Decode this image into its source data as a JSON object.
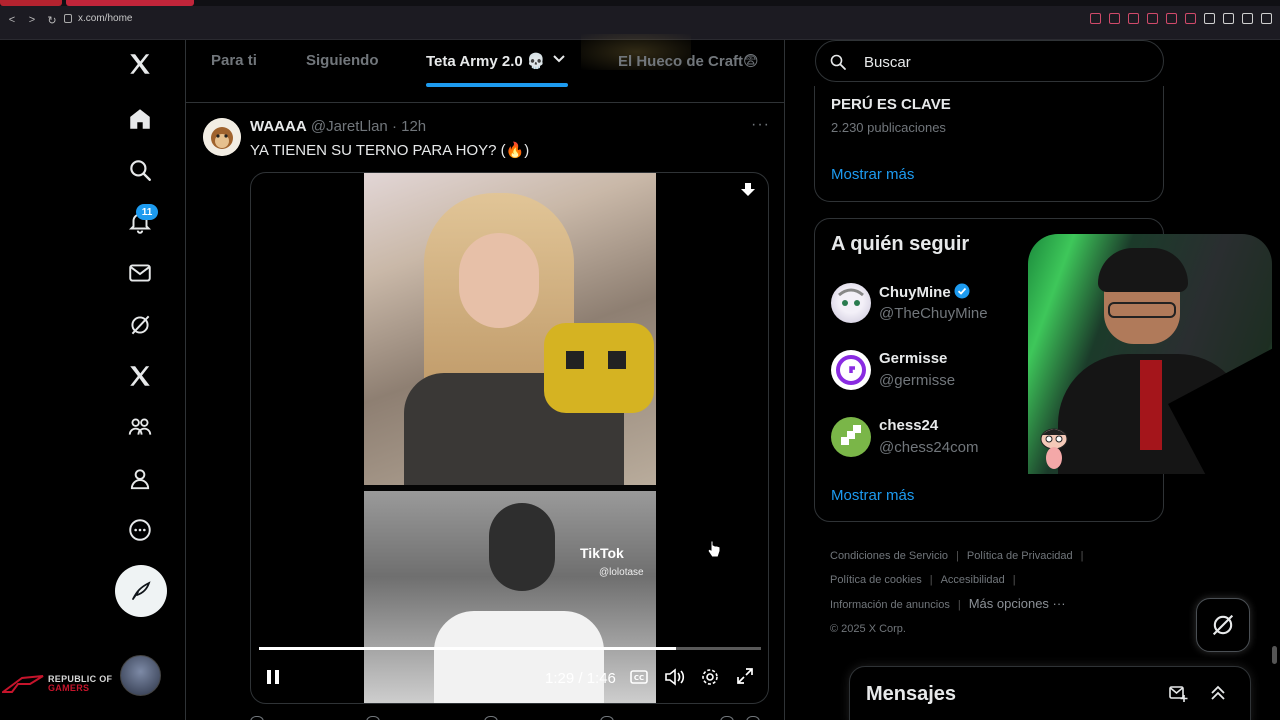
{
  "browser": {
    "url": "x.com/home"
  },
  "nav": {
    "notifications_count": "11"
  },
  "tabs": [
    {
      "label": "Para ti"
    },
    {
      "label": "Siguiendo"
    },
    {
      "label": "Teta Army 2.0 💀"
    },
    {
      "label": "El Hueco de Craft😨"
    }
  ],
  "post": {
    "name": "WAAAA",
    "handle": "@JaretLlan",
    "time": "· 12h",
    "text": "YA TIENEN SU TERNO PARA HOY? (🔥)",
    "more": "···"
  },
  "video": {
    "watermark": "TikTok",
    "watermark_handle": "@lolotase",
    "current_time": "1:29",
    "duration": "1:46",
    "time_display": "1:29 / 1:46",
    "progress": 0.83
  },
  "search": {
    "placeholder": "Buscar"
  },
  "trend": {
    "title": "PERÚ ES CLAVE",
    "count": "2.230 publicaciones",
    "show_more": "Mostrar más"
  },
  "who_to_follow": {
    "title": "A quién seguir",
    "accounts": [
      {
        "name": "ChuyMine",
        "handle": "@TheChuyMine"
      },
      {
        "name": "Germisse",
        "handle": "@germisse"
      },
      {
        "name": "chess24",
        "handle": "@chess24com"
      }
    ],
    "show_more": "Mostrar más"
  },
  "footer": {
    "terms": "Condiciones de Servicio",
    "privacy": "Política de Privacidad",
    "cookies": "Política de cookies",
    "accessibility": "Accesibilidad",
    "ads_info": "Información de anuncios",
    "more_options": "Más opciones ···",
    "copyright": "© 2025 X Corp."
  },
  "messages": {
    "title": "Mensajes"
  },
  "branding": {
    "rog_line1": "REPUBLIC OF",
    "rog_line2": "GAMERS"
  },
  "colors": {
    "accent": "#1d9bf0",
    "background": "#000000",
    "text": "#e7e9ea",
    "muted": "#71767b",
    "border": "#2f3336"
  }
}
